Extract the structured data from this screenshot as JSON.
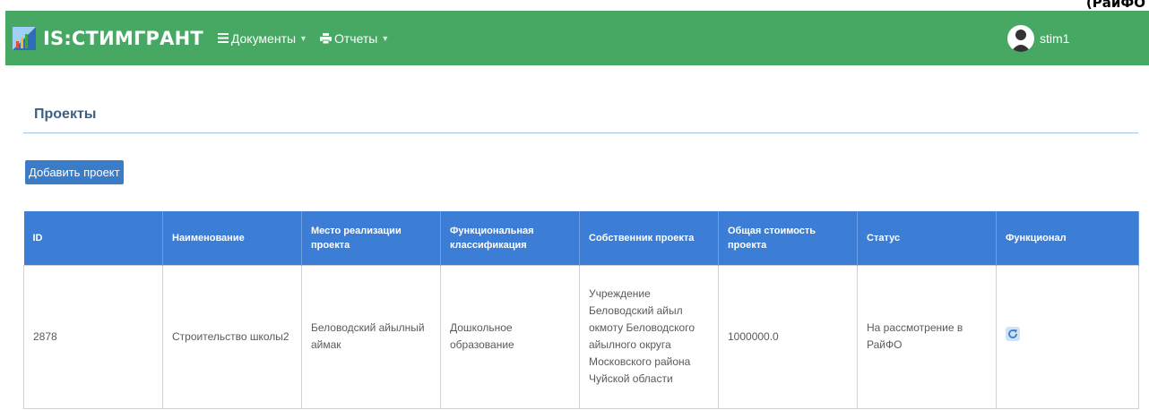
{
  "corner_text": "(РайФО",
  "navbar": {
    "brand": "IS:СТИМГРАНТ",
    "menu": [
      {
        "label": "Документы",
        "icon": "list-icon"
      },
      {
        "label": "Отчеты",
        "icon": "printer-icon"
      }
    ],
    "user": {
      "name": "stim1",
      "icon": "user-avatar-icon"
    }
  },
  "page": {
    "title": "Проекты",
    "add_button": "Добавить проект"
  },
  "table": {
    "columns": [
      "ID",
      "Наименование",
      "Место реализации проекта",
      "Функциональная классификация",
      "Собственник проекта",
      "Общая стоимость проекта",
      "Статус",
      "Функционал"
    ],
    "rows": [
      {
        "id": "2878",
        "name": "Строительство школы2",
        "location": "Беловодский айылный аймак",
        "classification": "Дошкольное образование",
        "owner": "Учреждение Беловодский айыл окмоту Беловодского айылного округа Московского района Чуйской области",
        "cost": "1000000.0",
        "status": "На рассмотрение в РайФО",
        "action_icon": "refresh-icon"
      }
    ]
  },
  "colors": {
    "navbar": "#47a864",
    "table_header": "#3c7ed6",
    "button": "#3a7cc8",
    "title": "#3c5f85"
  }
}
